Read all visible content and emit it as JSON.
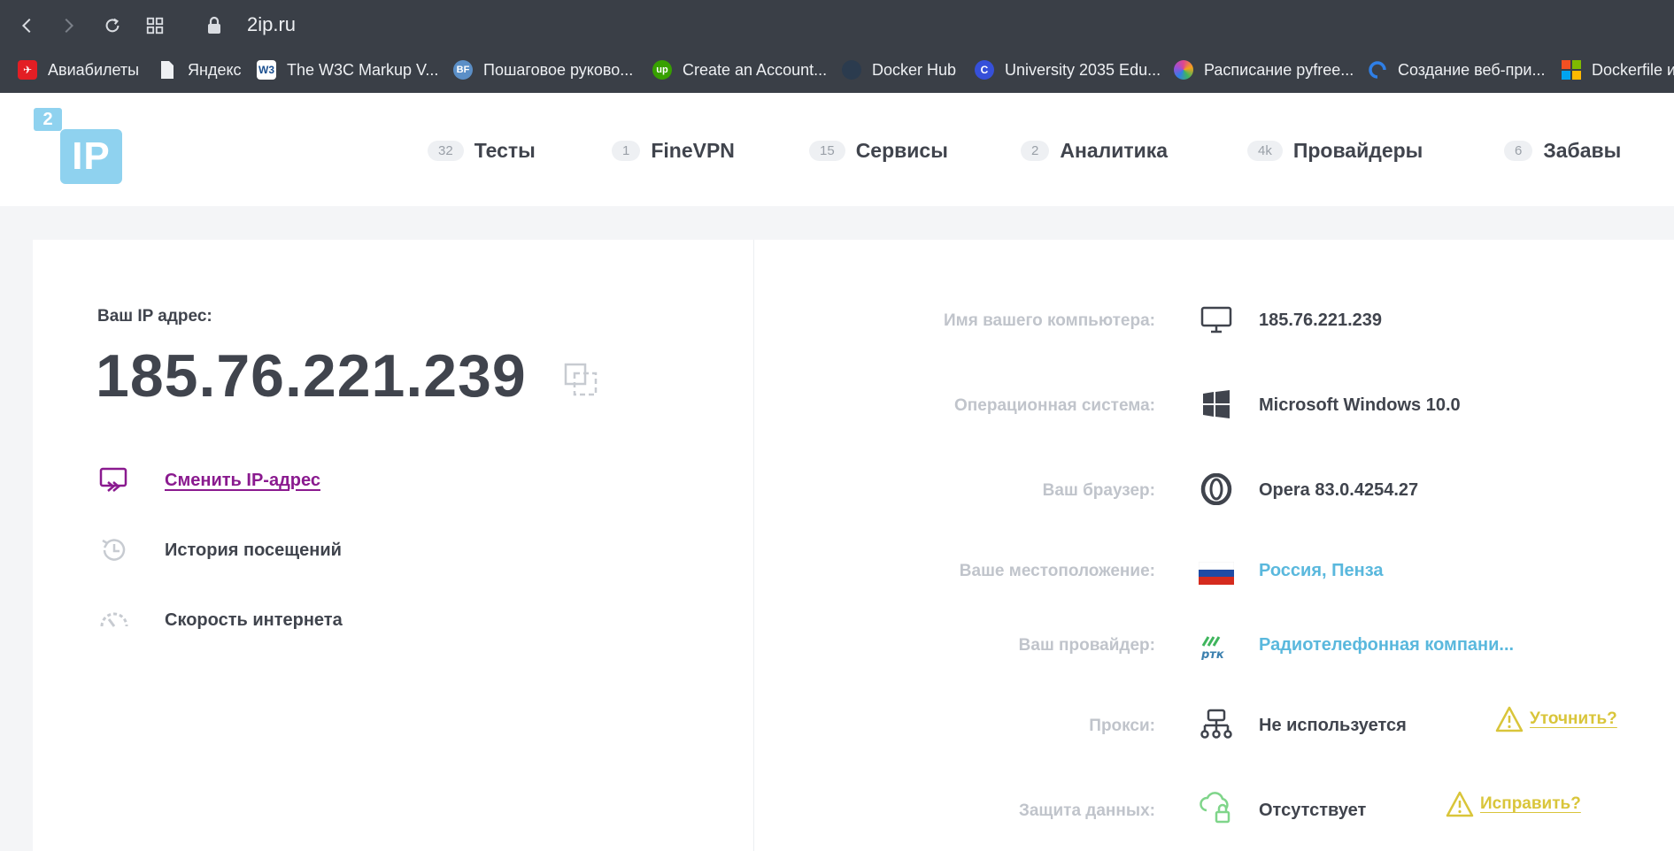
{
  "browser": {
    "url": "2ip.ru",
    "bookmarks": [
      {
        "label": "Авиабилеты",
        "icon": "aviasales-icon",
        "color": "#e31e24"
      },
      {
        "label": "Яндекс",
        "icon": "page-icon",
        "color": "#ffffff"
      },
      {
        "label": "The W3C Markup V...",
        "icon": "w3c-icon",
        "color": "#ffffff"
      },
      {
        "label": "Пошаговое руково...",
        "icon": "bf-icon",
        "color": "#5b8fc7"
      },
      {
        "label": "Create an Account...",
        "icon": "upwork-icon",
        "color": "#37a000"
      },
      {
        "label": "Docker Hub",
        "icon": "docker-icon",
        "color": "#2b3b4e"
      },
      {
        "label": "University 2035 Edu...",
        "icon": "university-icon",
        "color": "#3650d9"
      },
      {
        "label": "Расписание pyfree...",
        "icon": "pyfree-icon",
        "color": "#e0478d"
      },
      {
        "label": "Создание веб-при...",
        "icon": "digitalocean-icon",
        "color": "#2f7fe6"
      },
      {
        "label": "Dockerfile и",
        "icon": "microsoft-icon",
        "color": "#f25022"
      }
    ]
  },
  "header": {
    "logo_small": "2",
    "logo_big": "IP",
    "nav": [
      {
        "count": "32",
        "label": "Тесты"
      },
      {
        "count": "1",
        "label": "FineVPN"
      },
      {
        "count": "15",
        "label": "Сервисы"
      },
      {
        "count": "2",
        "label": "Аналитика"
      },
      {
        "count": "4k",
        "label": "Провайдеры"
      },
      {
        "count": "6",
        "label": "Забавы"
      }
    ]
  },
  "left": {
    "ip_label": "Ваш IP адрес:",
    "ip_value": "185.76.221.239",
    "actions": [
      {
        "label": "Сменить IP-адрес",
        "icon": "change-ip-icon"
      },
      {
        "label": "История посещений",
        "icon": "history-icon"
      },
      {
        "label": "Скорость интернета",
        "icon": "speedometer-icon"
      }
    ]
  },
  "right": {
    "rows": [
      {
        "label": "Имя вашего компьютера:",
        "value": "185.76.221.239",
        "icon": "monitor-icon"
      },
      {
        "label": "Операционная система:",
        "value": "Microsoft Windows 10.0",
        "icon": "windows-icon"
      },
      {
        "label": "Ваш браузер:",
        "value": "Opera 83.0.4254.27",
        "icon": "opera-icon"
      },
      {
        "label": "Ваше местоположение:",
        "value": "Россия, Пенза",
        "icon": "russia-flag-icon"
      },
      {
        "label": "Ваш провайдер:",
        "value": "Радиотелефонная компани...",
        "icon": "provider-logo-icon"
      },
      {
        "label": "Прокси:",
        "value": "Не используется",
        "icon": "network-icon",
        "action": "Уточнить?"
      },
      {
        "label": "Защита данных:",
        "value": "Отсутствует",
        "icon": "cloud-lock-icon",
        "action": "Исправить?"
      }
    ]
  },
  "colors": {
    "accent_link": "#8a1a8f",
    "info_link": "#5ab8dd",
    "warning": "#d9c53a",
    "logo": "#8fd2ef"
  }
}
